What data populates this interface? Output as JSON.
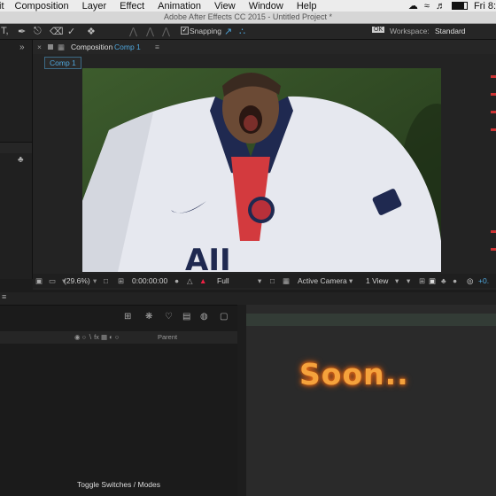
{
  "menubar": {
    "items": [
      "it",
      "Composition",
      "Layer",
      "Effect",
      "Animation",
      "View",
      "Window",
      "Help"
    ],
    "clock": "Fri 8:"
  },
  "app_title": "Adobe After Effects CC 2015 - Untitled Project *",
  "toolbar": {
    "snapping_label": "Snapping",
    "workspace_label": "Workspace:",
    "workspace_value": "Standard"
  },
  "composition_panel": {
    "header_label": "Composition",
    "header_comp": "Comp 1",
    "tab": "Comp 1"
  },
  "viewer_bar": {
    "zoom": "(29.6%)",
    "timecode": "0:00:00:00",
    "resolution": "Full",
    "camera": "Active Camera",
    "views": "1 View",
    "offset": "+0."
  },
  "timeline": {
    "parent_label": "Parent",
    "toggle_label": "Toggle Switches / Modes"
  },
  "overlay": {
    "text": "Soon.."
  }
}
